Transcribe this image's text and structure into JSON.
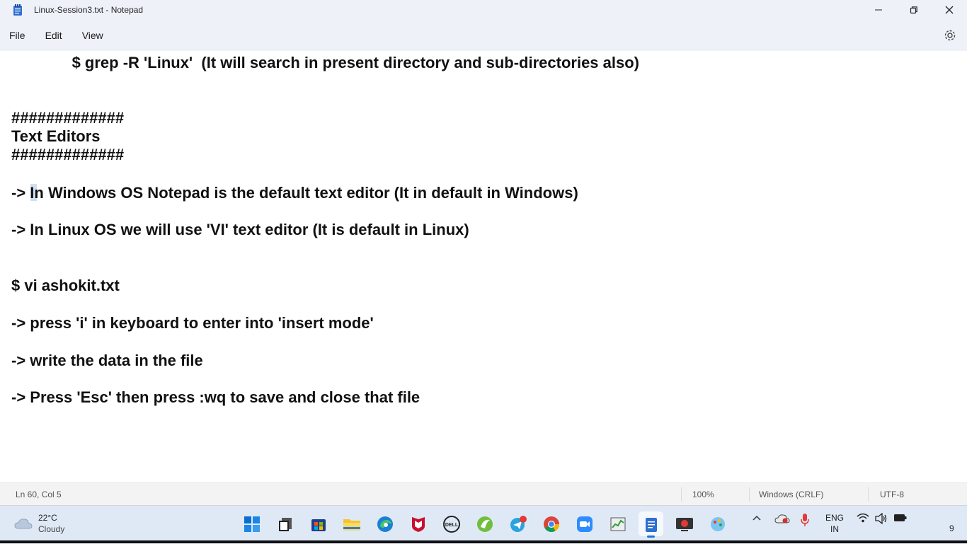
{
  "window": {
    "title": "Linux-Session3.txt - Notepad"
  },
  "menu": {
    "file": "File",
    "edit": "Edit",
    "view": "View"
  },
  "editor": {
    "lines": [
      "              $ grep -R 'Linux'  (It will search in present directory and sub-directories also)",
      "#############",
      "Text Editors",
      "#############",
      "-> In Windows OS Notepad is the default text editor (It in default in Windows)",
      "-> In Linux OS we will use 'VI' text editor (It is default in Linux)",
      "$ vi ashokit.txt",
      "-> press 'i' in keyboard to enter into 'insert mode'",
      "-> write the data in the file",
      "-> Press 'Esc' then press :wq to save and close that file"
    ]
  },
  "status": {
    "position": "Ln 60, Col 5",
    "zoom": "100%",
    "line_ending": "Windows (CRLF)",
    "encoding": "UTF-8"
  },
  "taskbar": {
    "weather_temp": "22°C",
    "weather_cond": "Cloudy",
    "lang_top": "ENG",
    "lang_bottom": "IN",
    "clock": "9",
    "icons": [
      "windows-start-icon",
      "files-icon",
      "store-icon",
      "file-explorer-icon",
      "edge-icon",
      "mcafee-icon",
      "dell-icon",
      "greenshot-icon",
      "telegram-icon",
      "chrome-icon",
      "zoom-icon",
      "task-manager-icon",
      "notepad-icon",
      "snip-icon",
      "paint-icon"
    ]
  },
  "colors": {
    "chrome_bg": "#eef2f8",
    "taskbar_bg": "#dfe9f6",
    "accent": "#1a73d9"
  }
}
